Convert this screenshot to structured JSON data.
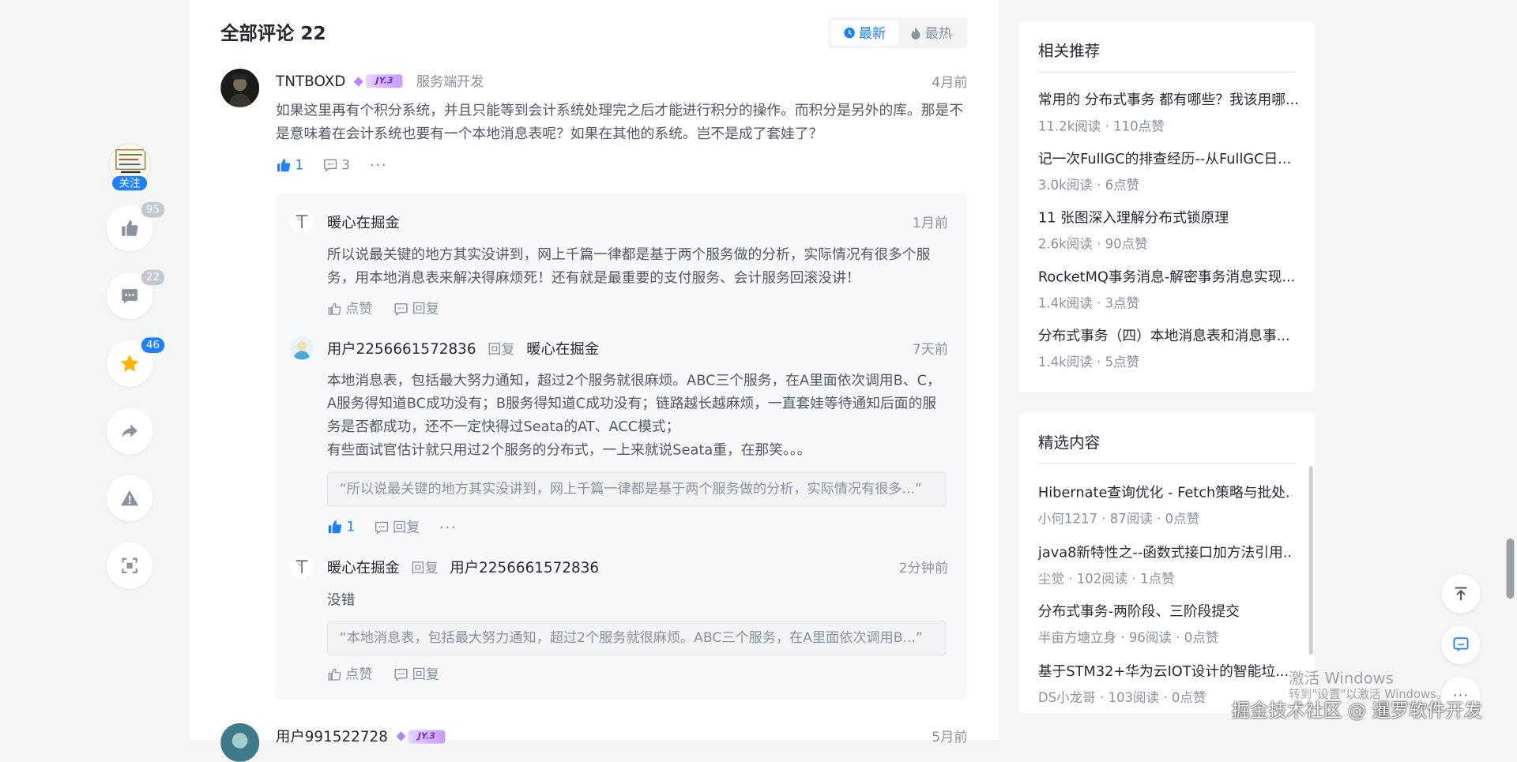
{
  "sidebar_actions": {
    "author_follow_label": "关注",
    "like_count": "95",
    "comment_count": "22",
    "collect_count": "46",
    "accent_color": "#1e80ff"
  },
  "comments_section": {
    "title": "全部评论 22",
    "sort_latest": "最新",
    "sort_hot": "最热"
  },
  "comments": [
    {
      "username": "TNTBOXD",
      "level": "JY.3",
      "job": "服务端开发",
      "time": "4月前",
      "text": "如果这里再有个积分系统，并且只能等到会计系统处理完之后才能进行积分的操作。而积分是另外的库。那是不是意味着在会计系统也要有一个本地消息表呢？如果在其他的系统。岂不是成了套娃了？",
      "likes": "1",
      "replies": "3",
      "more": "···"
    },
    {
      "username": "用户991522728",
      "level": "JY.3",
      "time": "5月前"
    }
  ],
  "replies": [
    {
      "username": "暖心在掘金",
      "time": "1月前",
      "text": "所以说最关键的地方其实没讲到，网上千篇一律都是基于两个服务做的分析，实际情况有很多个服务，用本地消息表来解决得麻烦死！还有就是最重要的支付服务、会计服务回滚没讲！",
      "like_label": "点赞",
      "reply_label": "回复"
    },
    {
      "username": "用户2256661572836",
      "reply_word": "回复",
      "reply_to": "暖心在掘金",
      "time": "7天前",
      "text": "本地消息表，包括最大努力通知，超过2个服务就很麻烦。ABC三个服务，在A里面依次调用B、C，A服务得知道BC成功没有；B服务得知道C成功没有；链路越长越麻烦，一直套娃等待通知后面的服务是否都成功，还不一定快得过Seata的AT、ACC模式；\n有些面试官估计就只用过2个服务的分布式，一上来就说Seata重，在那笑。。。",
      "quote": "“所以说最关键的地方其实没讲到，网上千篇一律都是基于两个服务做的分析，实际情况有很多...”",
      "likes": "1",
      "reply_label": "回复",
      "more": "···"
    },
    {
      "username": "暖心在掘金",
      "reply_word": "回复",
      "reply_to": "用户2256661572836",
      "time": "2分钟前",
      "text": "没错",
      "quote": "“本地消息表，包括最大努力通知，超过2个服务就很麻烦。ABC三个服务，在A里面依次调用B...”",
      "like_label": "点赞",
      "reply_label": "回复"
    }
  ],
  "related": {
    "title": "相关推荐",
    "items": [
      {
        "title": "常用的 分布式事务 都有哪些？我该用哪...",
        "meta": "11.2k阅读 · 110点赞"
      },
      {
        "title": "记一次FullGC的排查经历--从FullGC日...",
        "meta": "3.0k阅读 · 6点赞"
      },
      {
        "title": "11 张图深入理解分布式锁原理",
        "meta": "2.6k阅读 · 90点赞"
      },
      {
        "title": "RocketMQ事务消息-解密事务消息实现...",
        "meta": "1.4k阅读 · 3点赞"
      },
      {
        "title": "分布式事务（四）本地消息表和消息事...",
        "meta": "1.4k阅读 · 5点赞"
      }
    ]
  },
  "featured": {
    "title": "精选内容",
    "items": [
      {
        "title": "Hibernate查询优化 - Fetch策略与批处...",
        "meta": "小何1217 · 87阅读 · 0点赞"
      },
      {
        "title": "java8新特性之--函数式接口加方法引用...",
        "meta": "尘觉 · 102阅读 · 1点赞"
      },
      {
        "title": "分布式事务-两阶段、三阶段提交",
        "meta": "半亩方塘立身 · 96阅读 · 0点赞"
      },
      {
        "title": "基于STM32+华为云IOT设计的智能垃...",
        "meta": "DS小龙哥 · 103阅读 · 0点赞"
      }
    ]
  },
  "overlay": {
    "activate_title": "激活 Windows",
    "activate_sub": "转到\"设置\"以激活 Windows。",
    "watermark": "掘金技术社区 @ 暹罗软件开发"
  }
}
